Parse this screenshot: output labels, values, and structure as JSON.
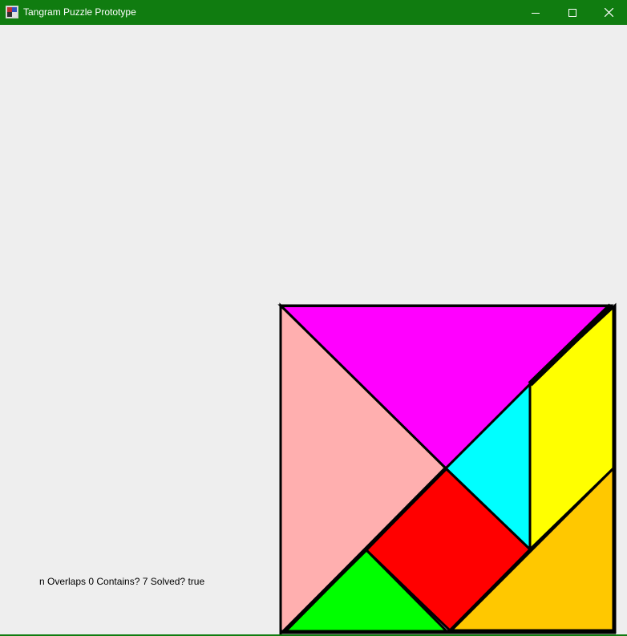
{
  "window": {
    "title": "Tangram Puzzle Prototype",
    "title_bar_color": "#107c10",
    "icons": [
      "app-icon",
      "minimize-icon",
      "maximize-icon",
      "close-icon"
    ]
  },
  "status": {
    "text": "n Overlaps 0 Contains? 7 Solved? true"
  },
  "pieces": [
    {
      "name": "large-triangle-top",
      "color": "#ff00ff"
    },
    {
      "name": "large-triangle-left",
      "color": "#ffafaf"
    },
    {
      "name": "small-triangle-cyan",
      "color": "#00ffff"
    },
    {
      "name": "parallelogram",
      "color": "#ffff00"
    },
    {
      "name": "square",
      "color": "#ff0000"
    },
    {
      "name": "small-triangle-green",
      "color": "#00ff00"
    },
    {
      "name": "medium-triangle",
      "color": "#ffc800"
    }
  ]
}
